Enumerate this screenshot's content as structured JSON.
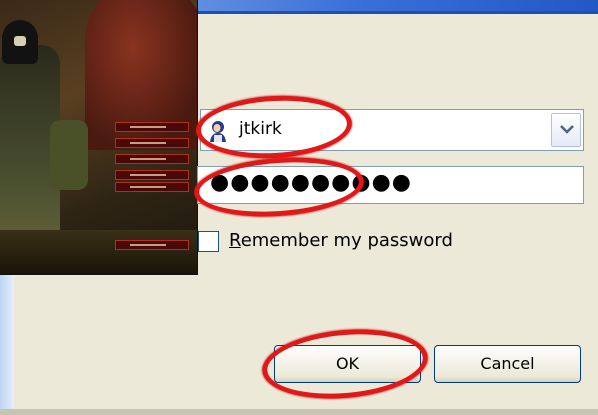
{
  "login": {
    "username": "jtkirk",
    "password_mask": "●●●●●●●●●●",
    "remember_label": "Remember my password",
    "remember_checked": false
  },
  "buttons": {
    "ok_label": "OK",
    "cancel_label": "Cancel"
  },
  "icons": {
    "user": "user-icon",
    "dropdown": "chevron-down-icon"
  },
  "colors": {
    "highlight_ring": "#e01818",
    "button_border": "#003c74"
  }
}
